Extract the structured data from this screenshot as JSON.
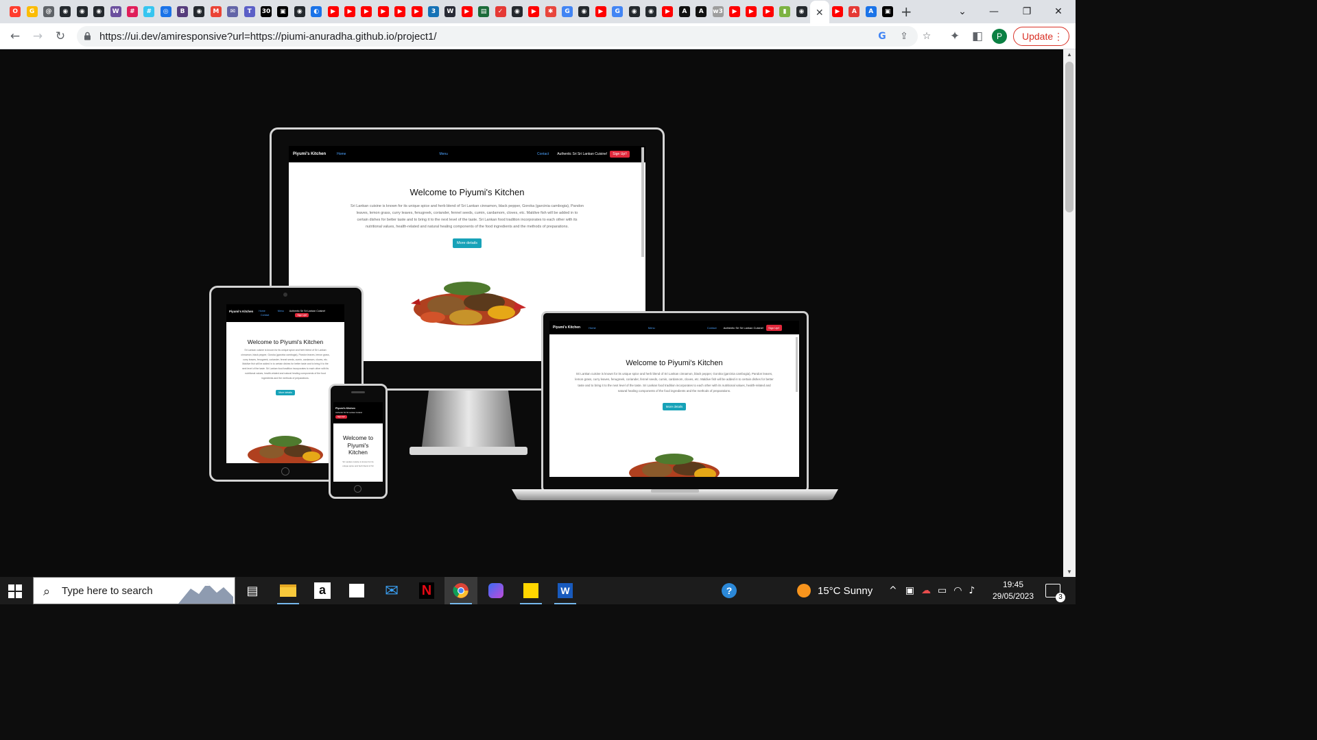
{
  "browser": {
    "tab_favicons": [
      {
        "name": "opera-icon",
        "color": "#ff3d2e",
        "glyph": "O"
      },
      {
        "name": "google-icon",
        "color": "#fbbc05",
        "glyph": "G"
      },
      {
        "name": "site-icon",
        "color": "#5f6368",
        "glyph": "@"
      },
      {
        "name": "github-icon",
        "color": "#24292e",
        "glyph": "◉"
      },
      {
        "name": "github-icon",
        "color": "#24292e",
        "glyph": "◉"
      },
      {
        "name": "github-icon",
        "color": "#24292e",
        "glyph": "◉"
      },
      {
        "name": "site-icon",
        "color": "#6b4f9e",
        "glyph": "W"
      },
      {
        "name": "slack-icon",
        "color": "#e01e5a",
        "glyph": "#"
      },
      {
        "name": "slack-icon",
        "color": "#36c5f0",
        "glyph": "#"
      },
      {
        "name": "chrome-icon",
        "color": "#1a73e8",
        "glyph": "◎"
      },
      {
        "name": "bootstrap-icon",
        "color": "#563d7c",
        "glyph": "B"
      },
      {
        "name": "github-icon",
        "color": "#24292e",
        "glyph": "◉"
      },
      {
        "name": "gmail-icon",
        "color": "#ea4335",
        "glyph": "M"
      },
      {
        "name": "mail-icon",
        "color": "#6264a7",
        "glyph": "✉"
      },
      {
        "name": "teams-icon",
        "color": "#5b5fc7",
        "glyph": "T"
      },
      {
        "name": "site-icon",
        "color": "#000000",
        "glyph": "30"
      },
      {
        "name": "site-icon",
        "color": "#000000",
        "glyph": "▣"
      },
      {
        "name": "github-icon",
        "color": "#24292e",
        "glyph": "◉"
      },
      {
        "name": "site-icon",
        "color": "#1a73e8",
        "glyph": "◐"
      },
      {
        "name": "youtube-icon",
        "color": "#ff0000",
        "glyph": "▶"
      },
      {
        "name": "youtube-icon",
        "color": "#ff0000",
        "glyph": "▶"
      },
      {
        "name": "youtube-icon",
        "color": "#ff0000",
        "glyph": "▶"
      },
      {
        "name": "youtube-icon",
        "color": "#ff0000",
        "glyph": "▶"
      },
      {
        "name": "youtube-icon",
        "color": "#ff0000",
        "glyph": "▶"
      },
      {
        "name": "youtube-icon",
        "color": "#ff0000",
        "glyph": "▶"
      },
      {
        "name": "css-icon",
        "color": "#1572b6",
        "glyph": "3"
      },
      {
        "name": "w3schools-icon",
        "color": "#282a35",
        "glyph": "W"
      },
      {
        "name": "youtube-icon",
        "color": "#ff0000",
        "glyph": "▶"
      },
      {
        "name": "site-icon",
        "color": "#1b6b3a",
        "glyph": "▤"
      },
      {
        "name": "site-icon",
        "color": "#e53935",
        "glyph": "✓"
      },
      {
        "name": "github-icon",
        "color": "#24292e",
        "glyph": "◉"
      },
      {
        "name": "youtube-icon",
        "color": "#ff0000",
        "glyph": "▶"
      },
      {
        "name": "site-icon",
        "color": "#e8453c",
        "glyph": "✱"
      },
      {
        "name": "google-icon",
        "color": "#4285f4",
        "glyph": "G"
      },
      {
        "name": "github-icon",
        "color": "#24292e",
        "glyph": "◉"
      },
      {
        "name": "youtube-icon",
        "color": "#ff0000",
        "glyph": "▶"
      },
      {
        "name": "google-icon",
        "color": "#4285f4",
        "glyph": "G"
      },
      {
        "name": "github-icon",
        "color": "#24292e",
        "glyph": "◉"
      },
      {
        "name": "github-icon",
        "color": "#24292e",
        "glyph": "◉"
      },
      {
        "name": "youtube-icon",
        "color": "#ff0000",
        "glyph": "▶"
      },
      {
        "name": "site-icon",
        "color": "#111111",
        "glyph": "A"
      },
      {
        "name": "site-icon",
        "color": "#111111",
        "glyph": "A"
      },
      {
        "name": "w3c-icon",
        "color": "#9e9e9e",
        "glyph": "w3"
      },
      {
        "name": "youtube-icon",
        "color": "#ff0000",
        "glyph": "▶"
      },
      {
        "name": "youtube-icon",
        "color": "#ff0000",
        "glyph": "▶"
      },
      {
        "name": "youtube-icon",
        "color": "#ff0000",
        "glyph": "▶"
      },
      {
        "name": "site-icon",
        "color": "#7cb342",
        "glyph": "▮"
      },
      {
        "name": "github-icon",
        "color": "#24292e",
        "glyph": "◉"
      }
    ],
    "active_tab_close": "✕",
    "tab_favicons_after": [
      {
        "name": "youtube-icon",
        "color": "#ff0000",
        "glyph": "▶"
      },
      {
        "name": "site-icon",
        "color": "#e53935",
        "glyph": "A"
      },
      {
        "name": "site-icon",
        "color": "#1a73e8",
        "glyph": "A"
      },
      {
        "name": "site-icon",
        "color": "#000000",
        "glyph": "▣"
      }
    ],
    "new_tab": "+",
    "url": "https://ui.dev/amiresponsive?url=https://piumi-anuradha.github.io/project1/",
    "profile_initial": "P",
    "update_label": "Update"
  },
  "site": {
    "brand": "Piyumi's Kitchen",
    "nav_home": "Home",
    "nav_menu": "Menu",
    "nav_contact": "Contact",
    "tagline": "Authentic Sri Sri Lankan Cuisine!",
    "signup": "Sign Up!!",
    "hero_title": "Welcome to Piyumi's Kitchen",
    "hero_text": "Sri Lankan cuisine is known for its unique spice and herb blend of Sri Lankan cinnamon, black pepper, Goroka (garcinia cambogia), Pandon leaves, lemon grass, curry leaves, fenugreek, coriander, fennel seeds, cumin, cardamom, cloves, etc. Maldive fish will be added in to certain dishes for better taste and to bring it to the next level of the taste. Sri Lankan food tradition incorporates to each other with its nutritional values, health-related and natural healing components of the food ingredients and the methods of preparations.",
    "hero_text_phone": "Sri Lankan cuisine is known for its unique spice and herb blend of Sri",
    "more_button": "More details"
  },
  "taskbar": {
    "search_placeholder": "Type here to search",
    "weather": "15°C  Sunny",
    "time": "19:45",
    "date": "29/05/2023",
    "notification_count": "3"
  }
}
